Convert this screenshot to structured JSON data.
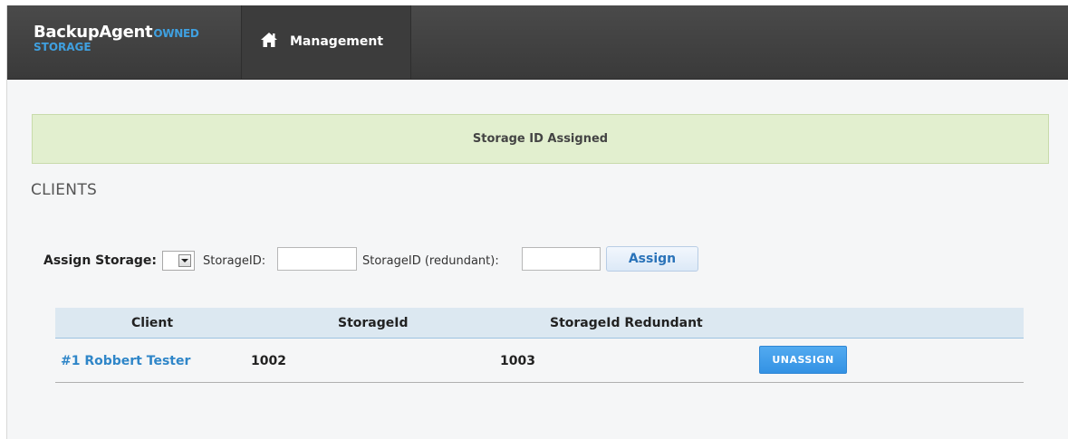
{
  "brand": {
    "name": "BackupAgent",
    "owned": "OWNED",
    "storage": "STORAGE",
    "accent": "#3fa0e0"
  },
  "nav": {
    "items": [
      {
        "label": "Management",
        "icon": "home-icon"
      }
    ]
  },
  "alert": {
    "message": "Storage ID Assigned",
    "color": "#e2efcf"
  },
  "section": {
    "title": "CLIENTS"
  },
  "assign_form": {
    "label": "Assign Storage:",
    "select_value": "",
    "storage_id_label": "StorageID:",
    "storage_id_value": "",
    "redundant_label": "StorageID (redundant):",
    "redundant_value": "",
    "button_label": "Assign"
  },
  "table": {
    "columns": [
      "Client",
      "StorageId",
      "StorageId Redundant"
    ],
    "rows": [
      {
        "client": "#1 Robbert Tester",
        "storage_id": "1002",
        "storage_id_redundant": "1003",
        "action_label": "UNASSIGN"
      }
    ]
  }
}
